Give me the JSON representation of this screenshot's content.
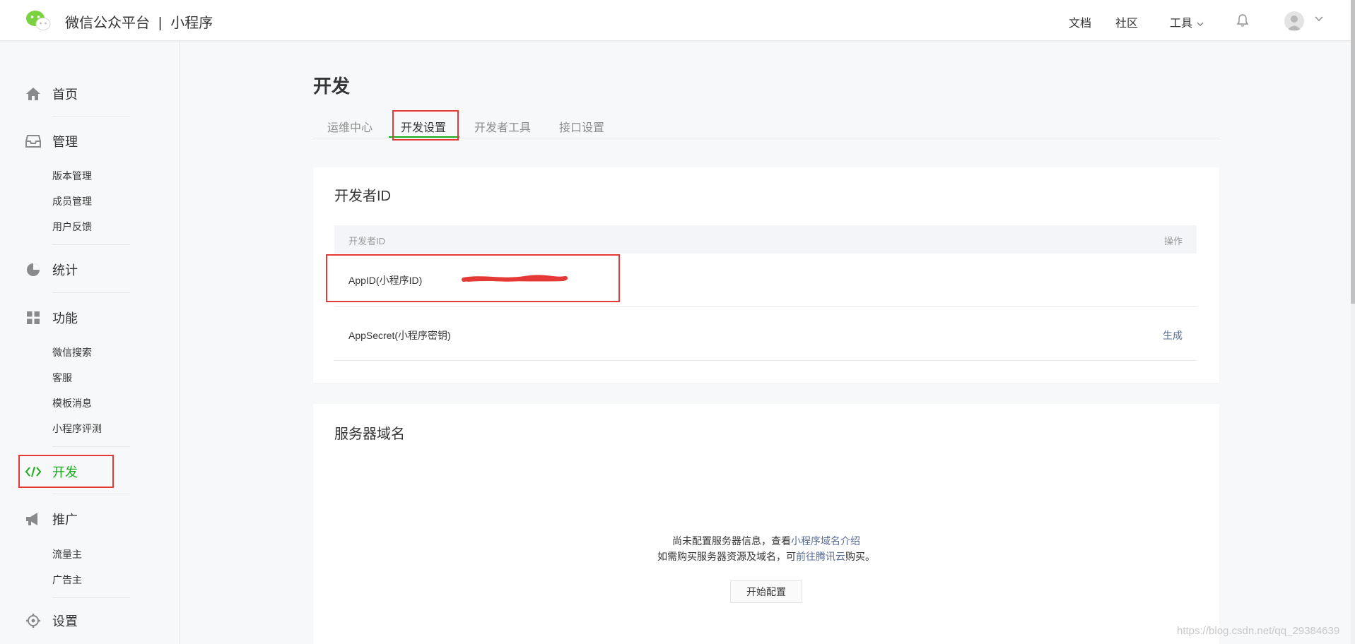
{
  "header": {
    "brand": "微信公众平台",
    "separator": "|",
    "product": "小程序",
    "nav": {
      "docs": "文档",
      "community": "社区",
      "tools": "工具"
    }
  },
  "sidebar": {
    "sections": [
      {
        "label": "首页",
        "icon": "home-icon",
        "items": []
      },
      {
        "label": "管理",
        "icon": "inbox-icon",
        "items": [
          "版本管理",
          "成员管理",
          "用户反馈"
        ]
      },
      {
        "label": "统计",
        "icon": "pie-chart-icon",
        "items": []
      },
      {
        "label": "功能",
        "icon": "grid-icon",
        "items": [
          "微信搜索",
          "客服",
          "模板消息",
          "小程序评测"
        ]
      },
      {
        "label": "开发",
        "icon": "code-icon",
        "items": [],
        "active": true
      },
      {
        "label": "推广",
        "icon": "megaphone-icon",
        "items": [
          "流量主",
          "广告主"
        ]
      },
      {
        "label": "设置",
        "icon": "gear-icon",
        "items": []
      }
    ]
  },
  "main": {
    "title": "开发",
    "tabs": [
      {
        "label": "运维中心",
        "active": false
      },
      {
        "label": "开发设置",
        "active": true
      },
      {
        "label": "开发者工具",
        "active": false
      },
      {
        "label": "接口设置",
        "active": false
      }
    ],
    "developer_id": {
      "title": "开发者ID",
      "columns": [
        "开发者ID",
        "操作"
      ],
      "rows": [
        {
          "name": "AppID(小程序ID)",
          "value": "",
          "action": ""
        },
        {
          "name": "AppSecret(小程序密钥)",
          "value": "",
          "action": "生成"
        }
      ]
    },
    "server_domain": {
      "title": "服务器域名",
      "line1_text": "尚未配置服务器信息，查看",
      "line1_link": "小程序域名介绍",
      "line2_text_a": "如需购买服务器资源及域名，可",
      "line2_link": "前往腾讯云",
      "line2_text_b": "购买。",
      "button": "开始配置"
    }
  },
  "watermark": "https://blog.csdn.net/qq_29384639",
  "colors": {
    "accent_green": "#1aad19",
    "link_blue": "#576b95",
    "annotation_red": "#e53935"
  }
}
